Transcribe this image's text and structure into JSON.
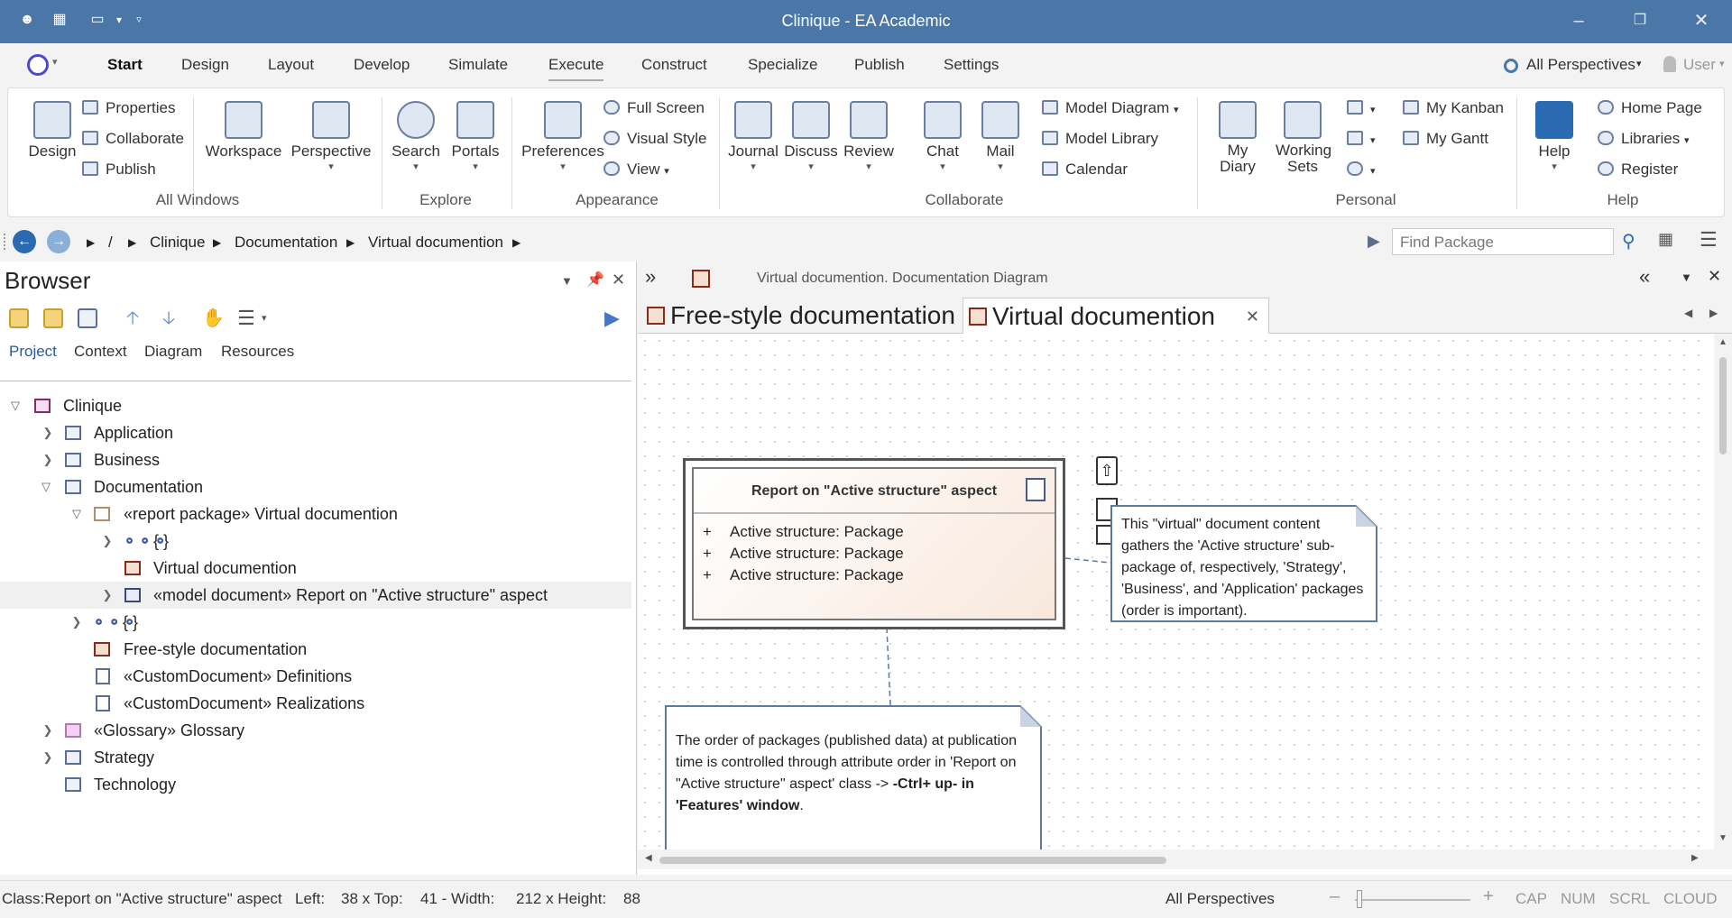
{
  "window": {
    "title": "Clinique - EA Academic"
  },
  "menu": {
    "tabs": [
      "Start",
      "Design",
      "Layout",
      "Develop",
      "Simulate",
      "Execute",
      "Construct",
      "Specialize",
      "Publish",
      "Settings"
    ],
    "perspectives": "All Perspectives",
    "user": "User"
  },
  "ribbon": {
    "design": "Design",
    "properties": "Properties",
    "collaborate": "Collaborate",
    "publish": "Publish",
    "workspace": "Workspace",
    "perspective": "Perspective",
    "search": "Search",
    "portals": "Portals",
    "preferences": "Preferences",
    "full_screen": "Full Screen",
    "visual_style": "Visual Style",
    "view": "View",
    "journal": "Journal",
    "discuss": "Discuss",
    "review": "Review",
    "chat": "Chat",
    "mail": "Mail",
    "model_diagram": "Model Diagram",
    "model_library": "Model Library",
    "calendar": "Calendar",
    "my_diary": "My Diary",
    "working_sets": "Working Sets",
    "my_kanban": "My Kanban",
    "my_gantt": "My Gantt",
    "help": "Help",
    "home_page": "Home Page",
    "libraries": "Libraries",
    "register": "Register",
    "groups": {
      "all_windows": "All Windows",
      "explore": "Explore",
      "appearance": "Appearance",
      "collaborate": "Collaborate",
      "personal": "Personal",
      "help": "Help"
    }
  },
  "nav": {
    "root": "/",
    "crumbs": [
      "Clinique",
      "Documentation",
      "Virtual documention"
    ],
    "find_placeholder": "Find Package"
  },
  "browser": {
    "title": "Browser",
    "tabs": [
      "Project",
      "Context",
      "Diagram",
      "Resources"
    ],
    "tree": [
      "Clinique",
      "Application",
      "Business",
      "Documentation",
      "«report package» Virtual documention",
      "{ }",
      "Virtual documention",
      "«model document» Report on \"Active structure\" aspect",
      "{ }",
      "Free-style documentation",
      "«CustomDocument» Definitions",
      "«CustomDocument» Realizations",
      "«Glossary» Glossary",
      "Strategy",
      "Technology"
    ]
  },
  "document": {
    "header": "Virtual documention.  Documentation Diagram",
    "tabs": [
      "Free-style documentation",
      "Virtual documention"
    ]
  },
  "diagram": {
    "class_title": "Report on \"Active structure\" aspect",
    "attr_prefix": "+",
    "attributes": [
      "Active structure: Package",
      "Active structure: Package",
      "Active structure: Package"
    ],
    "note1": "This \"virtual\" document content gathers the 'Active structure' sub-package of, respectively,  'Strategy', 'Business', and 'Application' packages (order is important).",
    "note2_a": "The order of packages (published data) at publication time is controlled through attribute order in 'Report on \"Active structure\" aspect' class -> ",
    "note2_b": "-Ctrl+ up- in 'Features' window",
    "note2_c": "."
  },
  "status": {
    "selection": "Class:Report on \"Active structure\" aspect",
    "left": "Left:",
    "left_val": "38 x Top:",
    "top_val": "41 - Width:",
    "width_val": "212 x Height:",
    "height_val": "88",
    "perspectives": "All Perspectives",
    "cap": "CAP",
    "num": "NUM",
    "scrl": "SCRL",
    "cloud": "CLOUD"
  }
}
